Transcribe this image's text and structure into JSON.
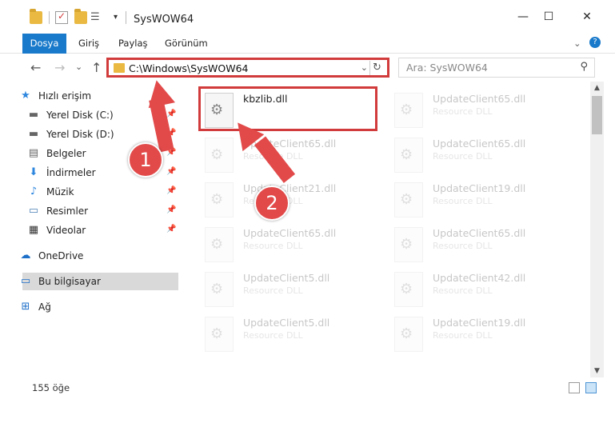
{
  "window": {
    "title": "SysWOW64",
    "minimize_glyph": "—",
    "maximize_glyph": "☐",
    "close_glyph": "✕"
  },
  "ribbon": {
    "tabs": [
      {
        "label": "Dosya"
      },
      {
        "label": "Giriş"
      },
      {
        "label": "Paylaş"
      },
      {
        "label": "Görünüm"
      }
    ],
    "expand_glyph": "⌄",
    "help_glyph": "?"
  },
  "navigation": {
    "back_glyph": "←",
    "forward_glyph": "→",
    "recent_glyph": "⌄",
    "up_glyph": "↑",
    "address": "C:\\Windows\\SysWOW64",
    "address_chevron": "⌄",
    "refresh_glyph": "↻",
    "search_placeholder": "Ara: SysWOW64",
    "search_glyph": "⚲"
  },
  "sidebar": {
    "items": [
      {
        "label": "Hızlı erişim",
        "icon": "star-icon",
        "glyph": "★",
        "color": "#2e86de",
        "pinned": false
      },
      {
        "label": "Yerel Disk (C:)",
        "icon": "drive-icon",
        "glyph": "▬",
        "color": "#666666",
        "pinned": true
      },
      {
        "label": "Yerel Disk (D:)",
        "icon": "drive-icon",
        "glyph": "▬",
        "color": "#666666",
        "pinned": true
      },
      {
        "label": "Belgeler",
        "icon": "documents-icon",
        "glyph": "▤",
        "color": "#666666",
        "pinned": true
      },
      {
        "label": "İndirmeler",
        "icon": "download-icon",
        "glyph": "⬇",
        "color": "#2e86de",
        "pinned": true
      },
      {
        "label": "Müzik",
        "icon": "music-icon",
        "glyph": "♪",
        "color": "#2e86de",
        "pinned": true
      },
      {
        "label": "Resimler",
        "icon": "pictures-icon",
        "glyph": "▭",
        "color": "#4a7fb5",
        "pinned": true
      },
      {
        "label": "Videolar",
        "icon": "videos-icon",
        "glyph": "▦",
        "color": "#333333",
        "pinned": true
      },
      {
        "label": "OneDrive",
        "icon": "cloud-icon",
        "glyph": "☁",
        "color": "#1e6fc8",
        "pinned": false
      },
      {
        "label": "Bu bilgisayar",
        "icon": "computer-icon",
        "glyph": "▭",
        "color": "#1e6fc8",
        "pinned": false,
        "selected": true
      },
      {
        "label": "Ağ",
        "icon": "network-icon",
        "glyph": "⊞",
        "color": "#1e6fc8",
        "pinned": false
      }
    ],
    "pin_glyph": "📌"
  },
  "files": [
    {
      "name": "kbzlib.dll",
      "type": "",
      "faded": false
    },
    {
      "name": "UpdateClient65.dll",
      "type": "Resource DLL",
      "faded": true
    },
    {
      "name": "UpdateClient65.dll",
      "type": "Resource DLL",
      "faded": true
    },
    {
      "name": "UpdateClient65.dll",
      "type": "Resource DLL",
      "faded": true
    },
    {
      "name": "UpdateClient21.dll",
      "type": "Resource DLL",
      "faded": true
    },
    {
      "name": "UpdateClient19.dll",
      "type": "Resource DLL",
      "faded": true
    },
    {
      "name": "UpdateClient65.dll",
      "type": "Resource DLL",
      "faded": true
    },
    {
      "name": "UpdateClient65.dll",
      "type": "Resource DLL",
      "faded": true
    },
    {
      "name": "UpdateClient5.dll",
      "type": "Resource DLL",
      "faded": true
    },
    {
      "name": "UpdateClient42.dll",
      "type": "Resource DLL",
      "faded": true
    },
    {
      "name": "UpdateClient5.dll",
      "type": "Resource DLL",
      "faded": true
    },
    {
      "name": "UpdateClient19.dll",
      "type": "Resource DLL",
      "faded": true
    }
  ],
  "status": {
    "item_count": "155 öğe"
  },
  "annotations": {
    "step1": "1",
    "step2": "2",
    "color": "#e24a4a"
  },
  "scroll": {
    "up_glyph": "▲",
    "down_glyph": "▼"
  }
}
